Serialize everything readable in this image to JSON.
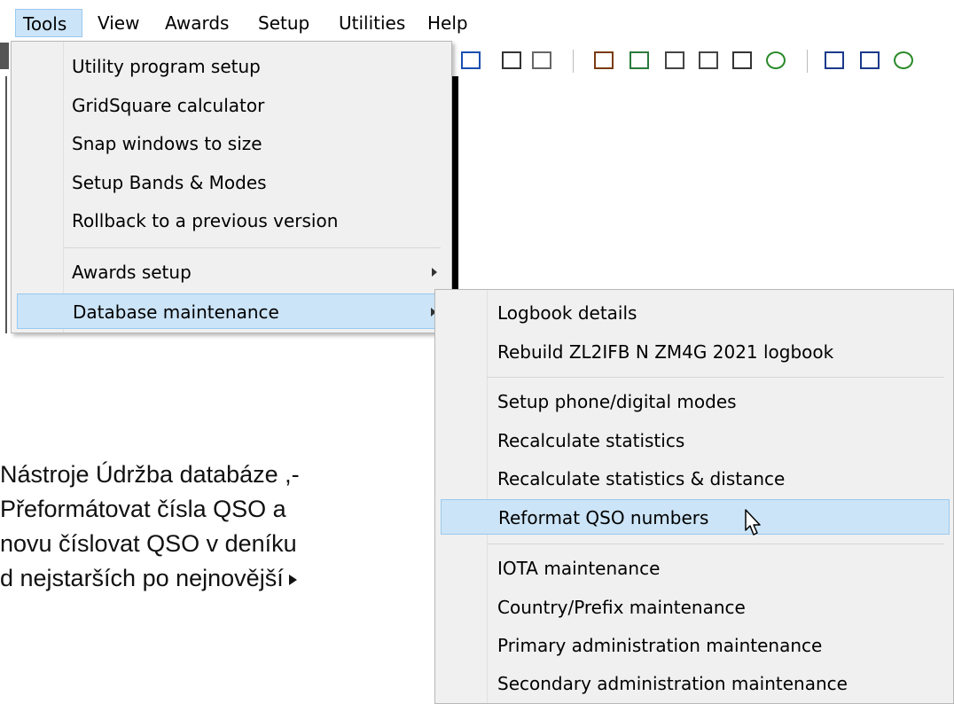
{
  "menubar": {
    "items": [
      "Tools",
      "View",
      "Awards",
      "Setup",
      "Utilities",
      "Help"
    ]
  },
  "tools_menu": {
    "items": [
      "Utility program setup",
      "GridSquare calculator",
      "Snap windows to size",
      "Setup Bands & Modes",
      "Rollback to a previous version",
      "Awards setup",
      "Database maintenance"
    ]
  },
  "db_menu": {
    "items": [
      "Logbook details",
      "Rebuild ZL2IFB N ZM4G 2021 logbook",
      "Setup phone/digital modes",
      "Recalculate statistics",
      "Recalculate statistics & distance",
      "Reformat QSO numbers",
      "IOTA maintenance",
      "Country/Prefix maintenance",
      "Primary administration maintenance",
      "Secondary administration maintenance"
    ]
  },
  "caption": {
    "lines": [
      "Nástroje Údržba databáze ,-",
      "Přeformátovat čísla QSO a",
      "novu  číslovat QSO v deníku",
      "d nejstarších po nejnovější"
    ]
  },
  "colors": {
    "highlight": "#cce4f7",
    "highlight_border": "#99c9ef",
    "menu_bg": "#f0f0f0"
  },
  "icons": [
    "mouse-pointer-icon",
    "submenu-arrow-icon",
    "toolbar-icon"
  ]
}
